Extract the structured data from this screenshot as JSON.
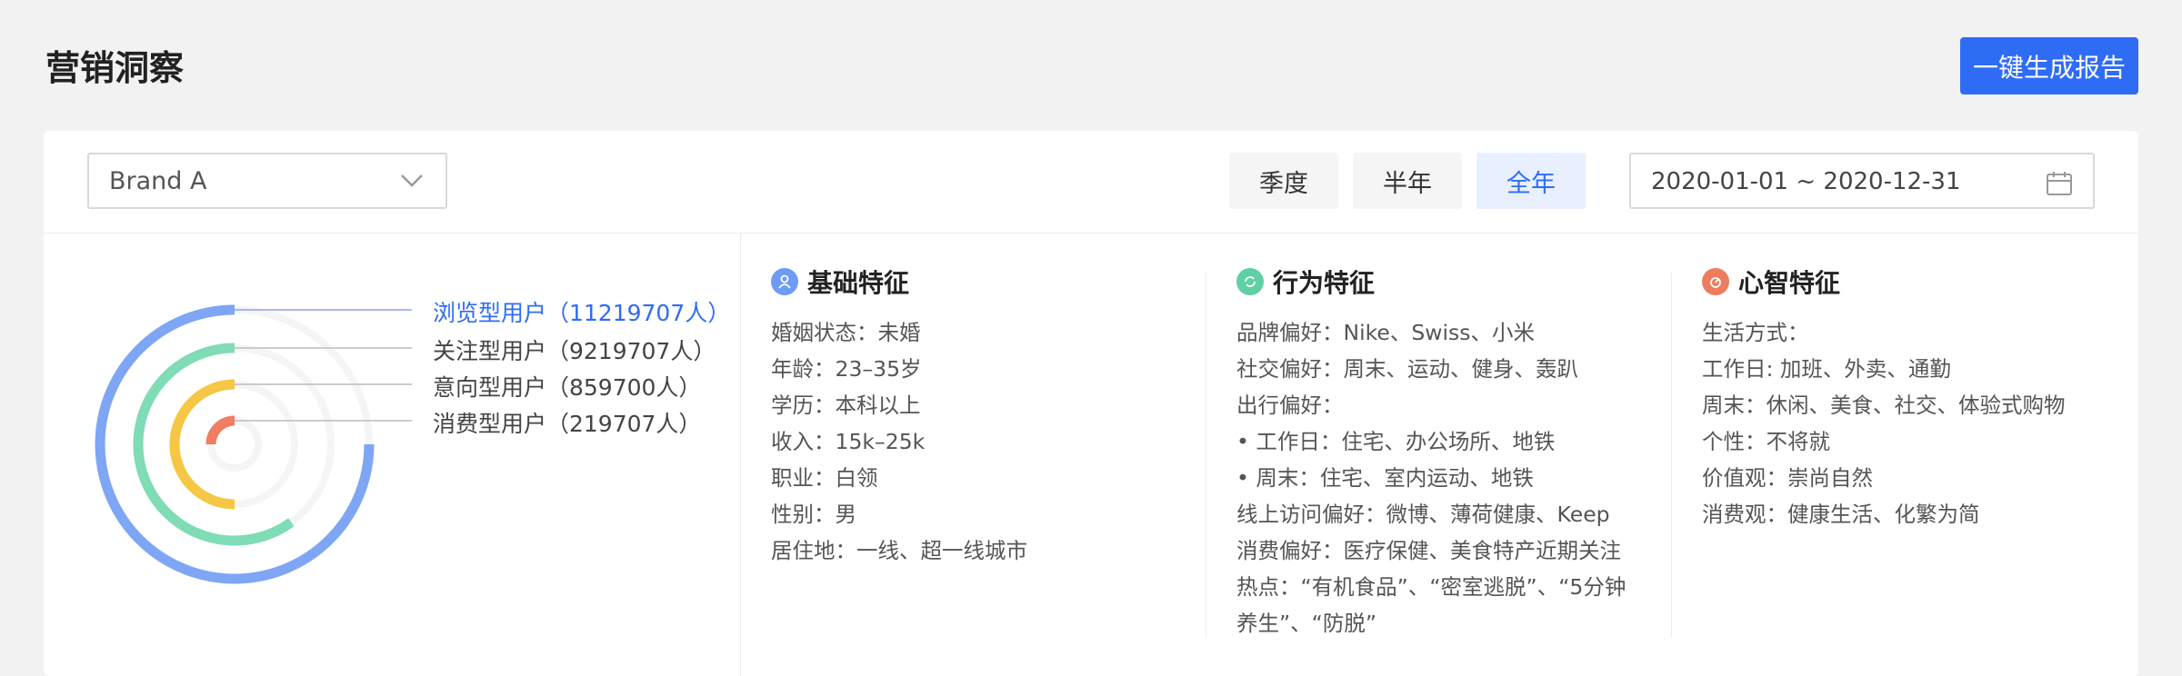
{
  "page": {
    "title": "营销洞察",
    "report_button": "一键生成报告"
  },
  "filters": {
    "brand": {
      "selected": "Brand A"
    },
    "periods": [
      {
        "label": "季度",
        "active": false
      },
      {
        "label": "半年",
        "active": false
      },
      {
        "label": "全年",
        "active": true
      }
    ],
    "date_range": "2020-01-01 ~ 2020-12-31"
  },
  "funnel": {
    "items": [
      {
        "label": "浏览型用户（11219707人）",
        "color": "#7ea6f4",
        "active": true,
        "fraction": 0.75
      },
      {
        "label": "关注型用户（9219707人）",
        "color": "#7fdcb5",
        "active": false,
        "fraction": 0.6
      },
      {
        "label": "意向型用户（859700人）",
        "color": "#f6c744",
        "active": false,
        "fraction": 0.5
      },
      {
        "label": "消费型用户（219707人）",
        "color": "#ef7e63",
        "active": false,
        "fraction": 0.25
      }
    ]
  },
  "columns": [
    {
      "title": "基础特征",
      "icon": "user-icon",
      "color": "#6d9cf5",
      "lines": [
        "婚姻状态：未婚",
        "年龄：23–35岁",
        "学历：本科以上",
        "收入：15k–25k",
        "职业：白领",
        "性别：男",
        "居住地：一线、超一线城市"
      ]
    },
    {
      "title": "行为特征",
      "icon": "behavior-icon",
      "color": "#5fd0a4",
      "lines": [
        "品牌偏好：Nike、Swiss、小米",
        "社交偏好：周末、运动、健身、轰趴",
        "出行偏好：",
        "• 工作日：住宅、办公场所、地铁",
        "• 周末：住宅、室内运动、地铁",
        "线上访问偏好：微博、薄荷健康、Keep",
        "消费偏好：医疗保健、美食特产近期关注",
        "热点：“有机食品”、“密室逃脱”、“5分钟养生”、“防脱”"
      ]
    },
    {
      "title": "心智特征",
      "icon": "mind-icon",
      "color": "#ee7c5f",
      "lines": [
        "生活方式：",
        "工作日: 加班、外卖、通勤",
        "周末：休闲、美食、社交、体验式购物",
        "个性：不将就",
        "价值观：崇尚自然",
        "消费观：健康生活、化繁为简"
      ]
    }
  ]
}
